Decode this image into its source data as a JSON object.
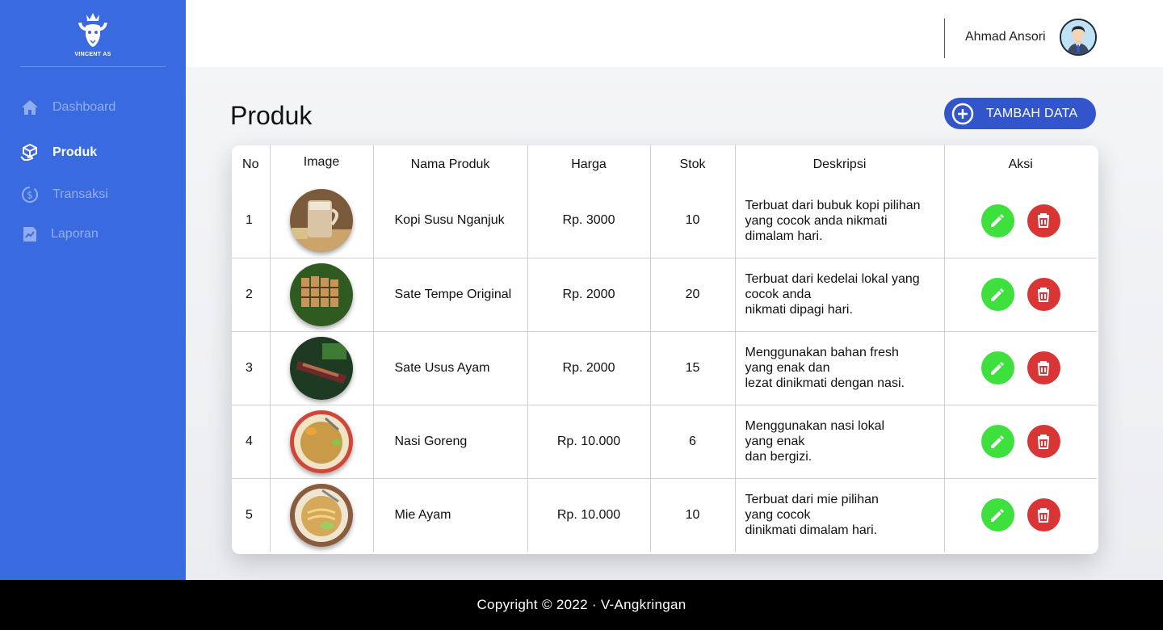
{
  "brand": {
    "name": "VINCENT AS",
    "logo_icon": "bull-crown-icon"
  },
  "sidebar": {
    "items": [
      {
        "label": "Dashboard",
        "icon": "home-icon",
        "active": false
      },
      {
        "label": "Produk",
        "icon": "box-hand-icon",
        "active": true
      },
      {
        "label": "Transaksi",
        "icon": "dollar-icon",
        "active": false
      },
      {
        "label": "Laporan",
        "icon": "report-icon",
        "active": false
      }
    ]
  },
  "header": {
    "user_name": "Ahmad Ansori"
  },
  "page": {
    "title": "Produk",
    "add_button": "TAMBAH DATA"
  },
  "table": {
    "columns": [
      "No",
      "Image",
      "Nama Produk",
      "Harga",
      "Stok",
      "Deskripsi",
      "Aksi"
    ],
    "rows": [
      {
        "no": "1",
        "nama": "Kopi Susu Nganjuk",
        "harga": "Rp. 3000",
        "stok": "10",
        "deskripsi": "Terbuat dari bubuk kopi pilihan\nyang cocok anda nikmati\ndimalam hari."
      },
      {
        "no": "2",
        "nama": "Sate Tempe Original",
        "harga": "Rp. 2000",
        "stok": "20",
        "deskripsi": "Terbuat dari kedelai lokal yang\ncocok anda\nnikmati dipagi hari."
      },
      {
        "no": "3",
        "nama": "Sate Usus Ayam",
        "harga": "Rp. 2000",
        "stok": "15",
        "deskripsi": "Menggunakan bahan fresh\nyang enak dan\nlezat dinikmati dengan nasi."
      },
      {
        "no": "4",
        "nama": "Nasi Goreng",
        "harga": "Rp. 10.000",
        "stok": "6",
        "deskripsi": "Menggunakan nasi lokal\nyang enak\ndan bergizi."
      },
      {
        "no": "5",
        "nama": "Mie Ayam",
        "harga": "Rp. 10.000",
        "stok": "10",
        "deskripsi": "Terbuat dari mie pilihan\nyang cocok\ndinikmati dimalam hari."
      }
    ]
  },
  "footer": {
    "text": "Copyright © 2022 · V-Angkringan"
  },
  "colors": {
    "sidebar": "#3a6ae0",
    "add_button": "#3355cc",
    "edit": "#3ee03e",
    "delete": "#d93535"
  }
}
